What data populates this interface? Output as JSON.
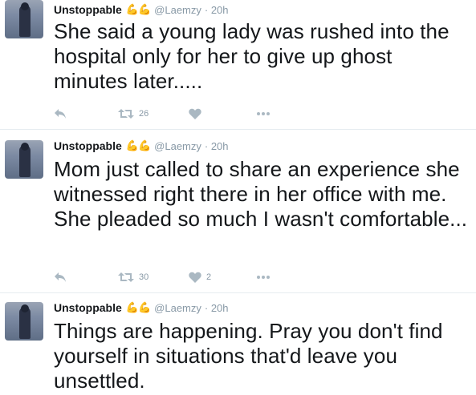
{
  "tweets": [
    {
      "name": "Unstoppable",
      "emoji": "💪💪",
      "handle": "@Laemzy",
      "time": "· 20h",
      "text": "She said a young lady was rushed into the hospital only for her to give up ghost minutes later.....",
      "retweets": "26",
      "likes": ""
    },
    {
      "name": "Unstoppable",
      "emoji": "💪💪",
      "handle": "@Laemzy",
      "time": "· 20h",
      "text": "Mom just called to share an experience she witnessed right there in her office with me. She pleaded so much I wasn't comfortable...",
      "retweets": "30",
      "likes": "2"
    },
    {
      "name": "Unstoppable",
      "emoji": "💪💪",
      "handle": "@Laemzy",
      "time": "· 20h",
      "text": "Things are happening. Pray you don't find yourself in situations that'd leave you unsettled."
    }
  ],
  "colors": {
    "action": "#aab8c2",
    "handle": "#8899a6",
    "separator": "#e6ecf0"
  }
}
